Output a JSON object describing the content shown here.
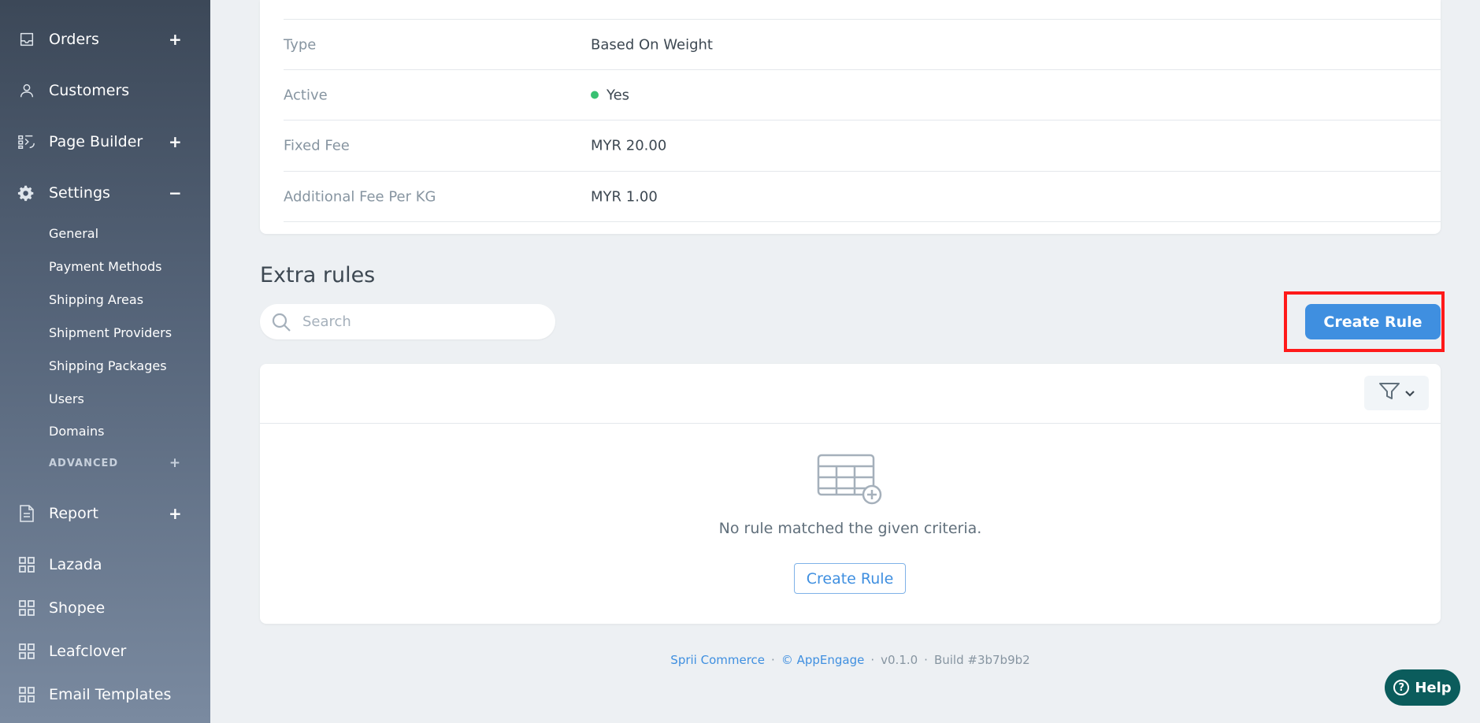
{
  "sidebar": {
    "nav_top": [
      {
        "label": "Orders",
        "icon": "inbox-icon",
        "toggle": "+"
      },
      {
        "label": "Customers",
        "icon": "user-icon",
        "toggle": ""
      },
      {
        "label": "Page Builder",
        "icon": "page-builder-icon",
        "toggle": "+"
      },
      {
        "label": "Settings",
        "icon": "gear-icon",
        "toggle": "−"
      }
    ],
    "settings_sub": [
      "General",
      "Payment Methods",
      "Shipping Areas",
      "Shipment Providers",
      "Shipping Packages",
      "Users",
      "Domains"
    ],
    "advanced_label": "ADVANCED",
    "advanced_toggle": "+",
    "nav_bottom": [
      {
        "label": "Report",
        "icon": "document-icon",
        "toggle": "+"
      },
      {
        "label": "Lazada",
        "icon": "grid-icon",
        "toggle": ""
      },
      {
        "label": "Shopee",
        "icon": "grid-icon",
        "toggle": ""
      },
      {
        "label": "Leafclover",
        "icon": "grid-icon",
        "toggle": ""
      },
      {
        "label": "Email Templates",
        "icon": "grid-icon",
        "toggle": ""
      }
    ]
  },
  "details": [
    {
      "label": "Type",
      "value": "Based On Weight"
    },
    {
      "label": "Active",
      "value": "Yes",
      "status_color": "#38c172"
    },
    {
      "label": "Fixed Fee",
      "value": "MYR 20.00"
    },
    {
      "label": "Additional Fee Per KG",
      "value": "MYR 1.00"
    }
  ],
  "extra_rules": {
    "title": "Extra rules",
    "search_placeholder": "Search",
    "create_button": "Create Rule",
    "empty_message": "No rule matched the given criteria.",
    "empty_create_button": "Create Rule"
  },
  "footer": {
    "brand": "Sprii Commerce",
    "copyright": "© AppEngage",
    "version": "v0.1.0",
    "build": "Build #3b7b9b2"
  },
  "help": {
    "label": "Help"
  },
  "colors": {
    "accent": "#3f8fe0",
    "highlight": "#ff1a1a",
    "help_bg": "#0b5c5c",
    "active_dot": "#38c172"
  }
}
